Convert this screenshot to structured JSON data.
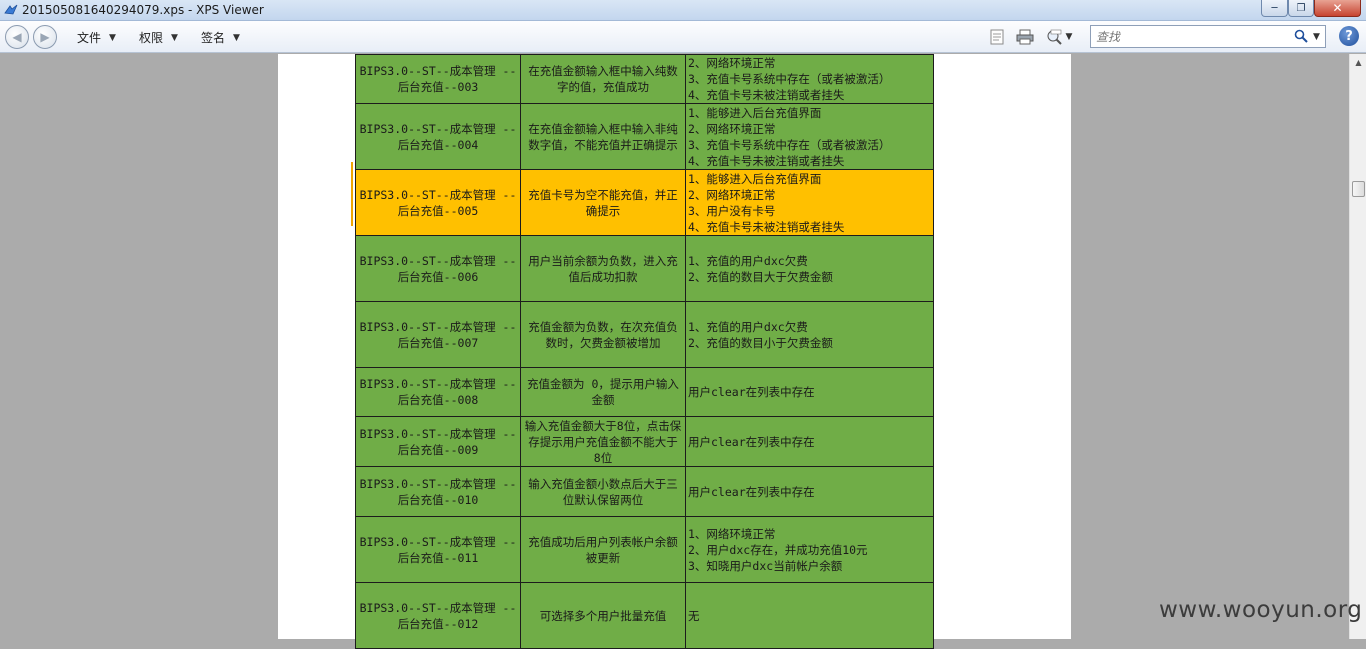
{
  "window": {
    "title": "201505081640294079.xps - XPS Viewer",
    "minimize_icon": "minimize-icon",
    "maximize_icon": "maximize-icon",
    "close_icon": "close-icon"
  },
  "toolbar": {
    "menus": [
      {
        "label": "文件"
      },
      {
        "label": "权限"
      },
      {
        "label": "签名"
      }
    ],
    "icons": [
      "page-view-icon",
      "print-icon",
      "zoom-icon"
    ],
    "search": {
      "placeholder": "查找"
    }
  },
  "table": {
    "rows": [
      {
        "id": "BIPS3.0--ST--成本管理 --后台充值--003",
        "desc": "在充值金额输入框中输入纯数字的值，充值成功",
        "pre": [
          "2、网络环境正常",
          "3、充值卡号系统中存在（或者被激活）",
          "4、充值卡号未被注销或者挂失"
        ]
      },
      {
        "id": "BIPS3.0--ST--成本管理 --后台充值--004",
        "desc": "在充值金额输入框中输入非纯数字值，不能充值并正确提示",
        "pre": [
          "1、能够进入后台充值界面",
          "2、网络环境正常",
          "3、充值卡号系统中存在（或者被激活）",
          "4、充值卡号未被注销或者挂失"
        ]
      },
      {
        "id": "BIPS3.0--ST--成本管理 --后台充值--005",
        "desc": "充值卡号为空不能充值，并正确提示",
        "pre": [
          "1、能够进入后台充值界面",
          "2、网络环境正常",
          "3、用户没有卡号",
          "4、充值卡号未被注销或者挂失"
        ]
      },
      {
        "id": "BIPS3.0--ST--成本管理 --后台充值--006",
        "desc": "用户当前余额为负数，进入充值后成功扣款",
        "pre": [
          "1、充值的用户dxc欠费",
          "2、充值的数目大于欠费金额"
        ]
      },
      {
        "id": "BIPS3.0--ST--成本管理 --后台充值--007",
        "desc": "充值金额为负数，在次充值负数时，欠费金额被增加",
        "pre": [
          "1、充值的用户dxc欠费",
          "2、充值的数目小于欠费金额"
        ]
      },
      {
        "id": "BIPS3.0--ST--成本管理 --后台充值--008",
        "desc": "充值金额为 0，提示用户输入金额",
        "pre": [
          "用户clear在列表中存在"
        ]
      },
      {
        "id": "BIPS3.0--ST--成本管理 --后台充值--009",
        "desc": "输入充值金额大于8位，点击保存提示用户充值金额不能大于 8位",
        "pre": [
          "用户clear在列表中存在"
        ]
      },
      {
        "id": "BIPS3.0--ST--成本管理 --后台充值--010",
        "desc": "输入充值金额小数点后大于三位默认保留两位",
        "pre": [
          "用户clear在列表中存在"
        ]
      },
      {
        "id": "BIPS3.0--ST--成本管理 --后台充值--011",
        "desc": "充值成功后用户列表帐户余额被更新",
        "pre": [
          "1、网络环境正常",
          "2、用户dxc存在，并成功充值10元",
          "3、知晓用户dxc当前帐户余额"
        ]
      },
      {
        "id": "BIPS3.0--ST--成本管理 --后台充值--012",
        "desc": "可选择多个用户批量充值",
        "pre": [
          "无"
        ]
      }
    ],
    "selected_row_index": 2,
    "colors": {
      "cell": "#70ad47",
      "selected": "#ffc000"
    }
  },
  "watermark": "www.wooyun.org"
}
